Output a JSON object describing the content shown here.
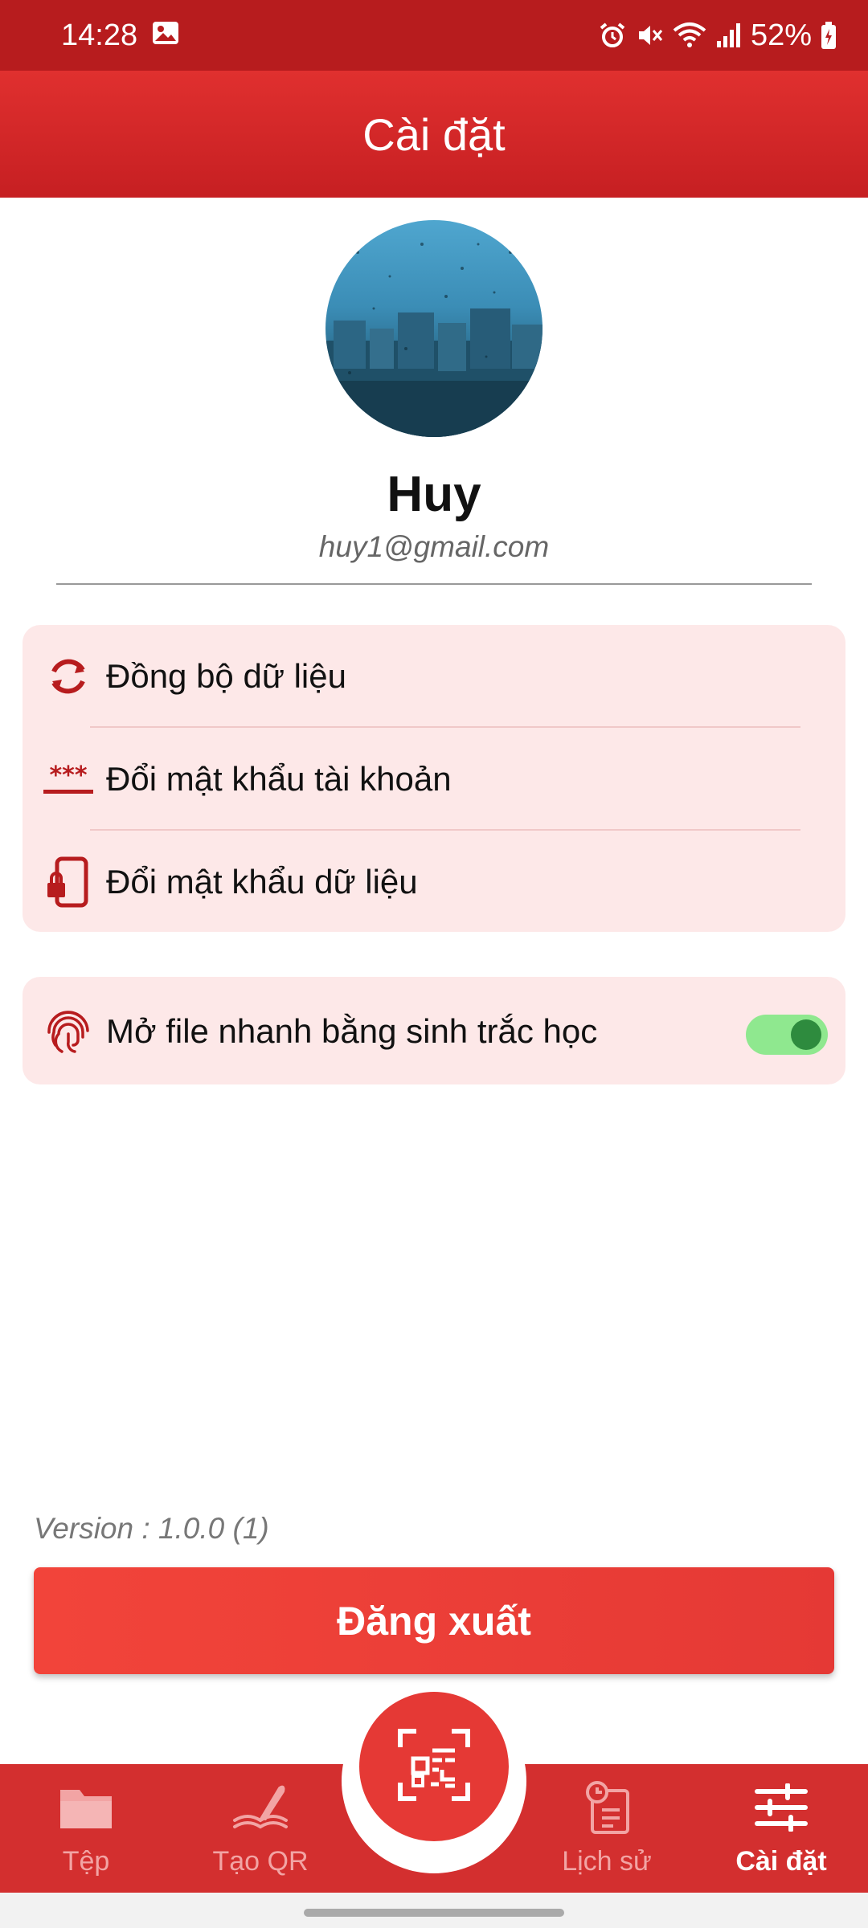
{
  "status_bar": {
    "time": "14:28",
    "battery": "52%",
    "icons": [
      "image-icon",
      "alarm-icon",
      "mute-icon",
      "wifi-icon",
      "signal-icon",
      "battery-icon"
    ]
  },
  "app_bar": {
    "title": "Cài đặt"
  },
  "profile": {
    "name": "Huy",
    "email": "huy1@gmail.com"
  },
  "settings": {
    "items": [
      {
        "label": "Đồng bộ dữ liệu",
        "icon": "sync-icon"
      },
      {
        "label": "Đổi mật khẩu tài khoản",
        "icon": "password-icon"
      },
      {
        "label": "Đổi mật khẩu dữ liệu",
        "icon": "phone-lock-icon"
      }
    ],
    "biometric": {
      "label": "Mở file nhanh bằng sinh trắc học",
      "icon": "fingerprint-icon",
      "enabled": true
    }
  },
  "version": "Version : 1.0.0 (1)",
  "logout_label": "Đăng xuất",
  "bottom_nav": {
    "items": [
      {
        "label": "Tệp",
        "icon": "folder-icon",
        "active": false
      },
      {
        "label": "Tạo QR",
        "icon": "create-qr-icon",
        "active": false
      },
      {
        "label": "Lịch sử",
        "icon": "history-icon",
        "active": false
      },
      {
        "label": "Cài đặt",
        "icon": "settings-sliders-icon",
        "active": true
      }
    ],
    "center_icon": "qr-scan-icon"
  },
  "colors": {
    "primary": "#d32f2f",
    "status_bar": "#b71c1e",
    "card_bg": "#fde8e8",
    "toggle_track": "#8fe88f",
    "toggle_knob": "#2e8b3e"
  }
}
